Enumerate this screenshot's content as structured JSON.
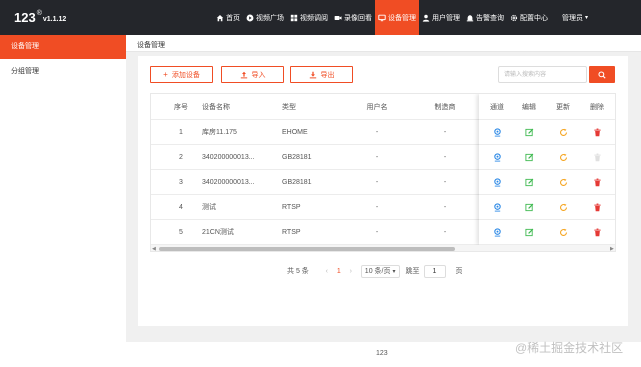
{
  "app": {
    "brand": "123",
    "reg_mark": "®",
    "version": "v1.1.12"
  },
  "colors": {
    "accent": "#f04d24",
    "topbar": "#24262b",
    "detail_icon": "#2e8ae6",
    "edit_icon": "#3fb950",
    "update_icon": "#f5a623",
    "delete_icon": "#e53935"
  },
  "nav": {
    "items": [
      {
        "icon": "home-icon",
        "label": "首页"
      },
      {
        "icon": "video-square-icon",
        "label": "视频广场"
      },
      {
        "icon": "grid-icon",
        "label": "视频调阅"
      },
      {
        "icon": "camera-icon",
        "label": "录像回看"
      },
      {
        "icon": "device-icon",
        "label": "设备管理"
      },
      {
        "icon": "user-icon",
        "label": "用户管理"
      },
      {
        "icon": "alarm-icon",
        "label": "告警查询"
      },
      {
        "icon": "gear-icon",
        "label": "配置中心"
      }
    ],
    "active_index": 4,
    "user": "管理员"
  },
  "sidebar": {
    "items": [
      {
        "label": "设备管理"
      },
      {
        "label": "分组管理"
      }
    ],
    "active_index": 0
  },
  "breadcrumb": "设备管理",
  "toolbar": {
    "add_label": "添加设备",
    "import_label": "导入",
    "export_label": "导出",
    "search_placeholder": "请输入搜索内容"
  },
  "table": {
    "columns": {
      "index": "序号",
      "name": "设备名称",
      "type": "类型",
      "username": "用户名",
      "manufacturer": "制造商",
      "channel": "通道",
      "edit": "编辑",
      "update": "更新",
      "delete": "删除"
    },
    "rows": [
      {
        "index": "1",
        "name": "库房11.175",
        "type": "EHOME",
        "username": "-",
        "manufacturer": "-",
        "delete_disabled": false
      },
      {
        "index": "2",
        "name": "340200000013...",
        "type": "GB28181",
        "username": "-",
        "manufacturer": "-",
        "delete_disabled": true
      },
      {
        "index": "3",
        "name": "340200000013...",
        "type": "GB28181",
        "username": "-",
        "manufacturer": "-",
        "delete_disabled": false
      },
      {
        "index": "4",
        "name": "测试",
        "type": "RTSP",
        "username": "-",
        "manufacturer": "-",
        "delete_disabled": false
      },
      {
        "index": "5",
        "name": "21CN测试",
        "type": "RTSP",
        "username": "-",
        "manufacturer": "-",
        "delete_disabled": false
      }
    ]
  },
  "pagination": {
    "total": "共 5 条",
    "current": "1",
    "page_size": "10 条/页",
    "jump_label": "跳至",
    "jump_value": "1",
    "unit": "页"
  },
  "footer": "123",
  "watermark": "@稀土掘金技术社区"
}
